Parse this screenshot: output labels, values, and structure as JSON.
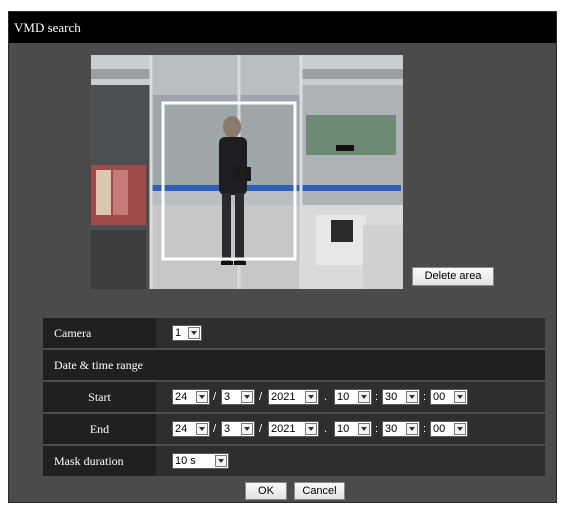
{
  "dialog": {
    "title": "VMD search"
  },
  "buttons": {
    "delete_area": "Delete area",
    "ok": "OK",
    "cancel": "Cancel"
  },
  "form": {
    "camera_label": "Camera",
    "camera_value": "1",
    "date_range_label": "Date & time range",
    "start_label": "Start",
    "end_label": "End",
    "start": {
      "day": "24",
      "month": "3",
      "year": "2021",
      "hour": "10",
      "minute": "30",
      "second": "00"
    },
    "end": {
      "day": "24",
      "month": "3",
      "year": "2021",
      "hour": "10",
      "minute": "30",
      "second": "00"
    },
    "separators": {
      "date": "/",
      "datetime": ".",
      "time": ":"
    },
    "mask_label": "Mask duration",
    "mask_value": "10 s"
  },
  "colors": {
    "titlebar": "#000000",
    "dialog_bg": "#4b4b4b",
    "row_bg": "#202020",
    "field_bg": "#2e2e2e",
    "detect_area": "#ffffff"
  }
}
